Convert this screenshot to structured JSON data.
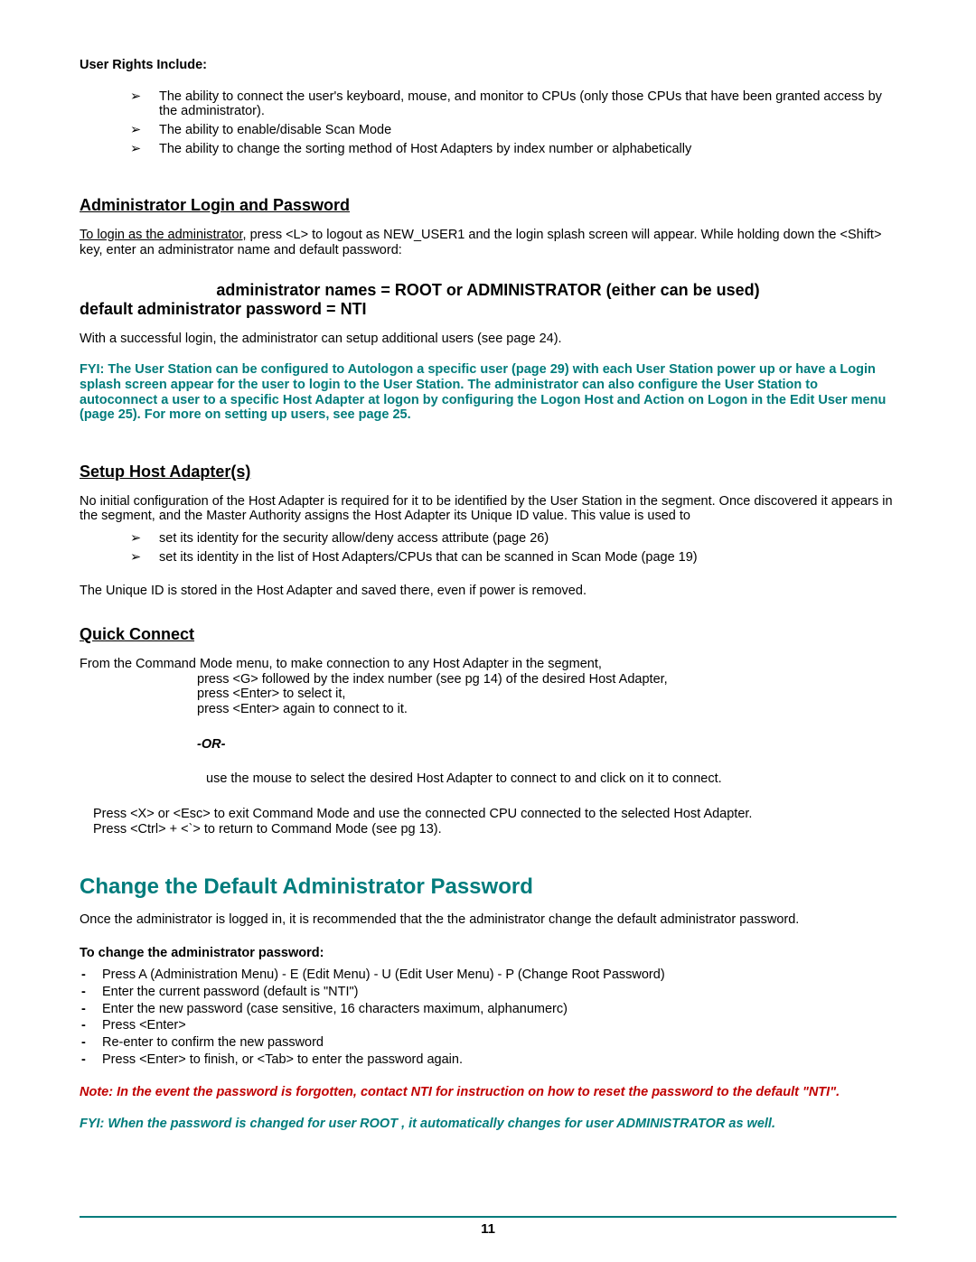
{
  "rights_label": "User Rights Include:",
  "rights": [
    "The ability to connect the user's keyboard, mouse, and monitor to CPUs  (only those CPUs that have been granted access by the administrator).",
    "The ability to enable/disable Scan Mode",
    "The ability to change the sorting method of Host Adapters by index number or alphabetically"
  ],
  "admin_login": {
    "heading": "Administrator Login and Password",
    "para_lead": "To login as the administrator,",
    "para_rest": "  press <L> to logout as NEW_USER1 and the login splash screen will appear.  While holding down the <Shift> key, enter an administrator name and default password:",
    "names_line": "administrator names  =  ROOT   or  ADMINISTRATOR (either can be used)",
    "default_line": "default administrator password   =  NTI",
    "success": "With a successful login, the administrator can setup additional users (see page 24).",
    "fyi": "FYI: The User Station can be configured to Autologon a specific user (page 29) with each User Station power up or have a Login splash screen appear for the user to login to the User Station.    The administrator can also configure the User Station to autoconnect a user to a specific Host Adapter at logon by configuring the Logon Host and Action on Logon in the Edit User menu (page 25).   For more on setting up users, see page 25."
  },
  "host": {
    "heading": "Setup Host Adapter(s)",
    "para1": "No initial configuration of the Host Adapter is required for it to be identified by the User Station in the segment.    Once discovered it appears in the segment, and the Master Authority assigns the Host Adapter its Unique ID value.    This value is used to",
    "bullets": [
      "set its identity for the security allow/deny access attribute (page 26)",
      "set its identity in the list of Host Adapters/CPUs that can be scanned in Scan Mode (page 19)"
    ],
    "para2": "The Unique ID is stored in the Host Adapter and saved there, even if power is removed."
  },
  "quick": {
    "heading": "Quick Connect",
    "l1": "From the Command Mode menu,  to make connection to any Host Adapter in the segment,",
    "l2": "press <G> followed by the index number (see pg 14) of the desired Host Adapter,",
    "l3": "press <Enter> to select it,",
    "l4": "press <Enter> again to connect to it.",
    "or": "-OR-",
    "l5": "use the mouse to select the desired Host Adapter to connect to and click on it to connect.",
    "l6": "Press <X> or <Esc> to exit Command Mode and use the connected CPU connected to the selected Host Adapter.",
    "l7": "Press <Ctrl> + <`> to return to Command Mode (see pg 13)."
  },
  "change": {
    "heading": "Change the Default Administrator Password",
    "intro": "Once the administrator is logged in,  it is recommended that the the administrator change the default administrator password.",
    "sub": "To change the administrator password:",
    "steps": [
      "Press A (Administration Menu) -  E (Edit Menu) - U (Edit User Menu) - P (Change Root Password)",
      "Enter the current password (default is \"NTI\")",
      "Enter the new password (case sensitive, 16 characters maximum,  alphanumerc)",
      "Press <Enter>",
      "Re-enter to confirm the new password",
      "Press <Enter> to finish,  or <Tab> to enter the password again."
    ],
    "note": "Note:  In the event the password is forgotten, contact NTI for instruction on how to reset the password to the default \"NTI\".",
    "fyi": "FYI:  When the password is changed for user ROOT ,  it automatically changes for user ADMINISTRATOR as well."
  },
  "page_number": "11"
}
